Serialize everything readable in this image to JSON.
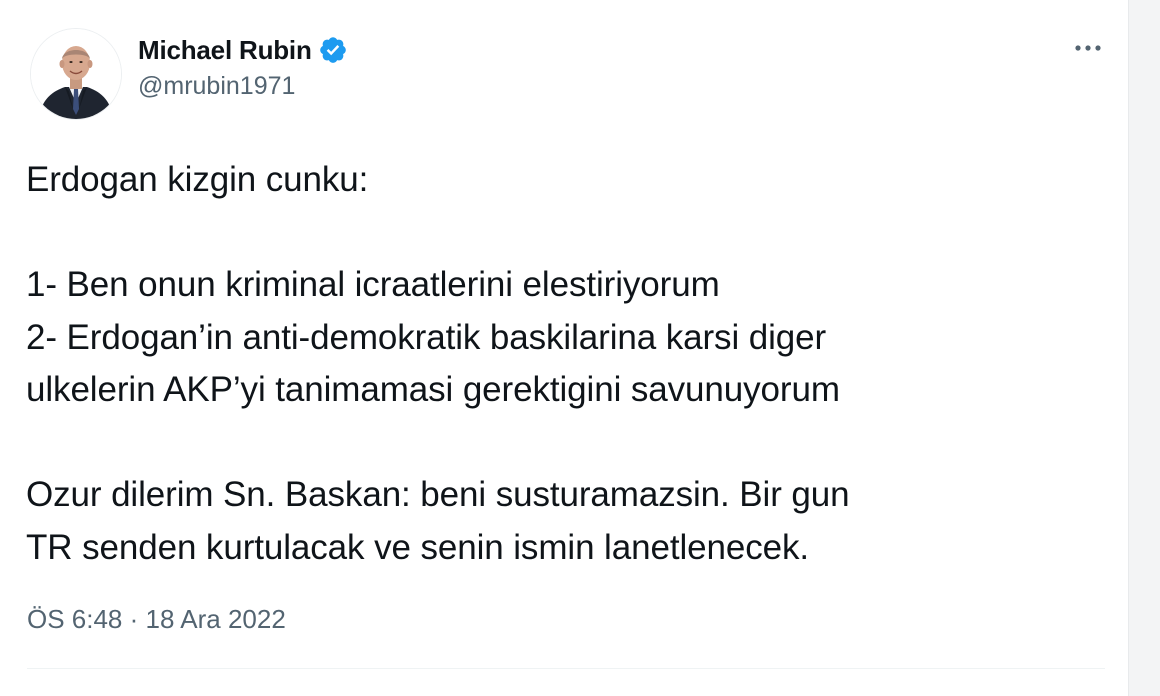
{
  "author": {
    "display_name": "Michael Rubin",
    "handle": "@mrubin1971",
    "verified": true,
    "avatar": "profile-photo"
  },
  "tweet": {
    "lines": [
      "Erdogan kizgin cunku:",
      "",
      "1- Ben onun kriminal icraatlerini elestiriyorum",
      "2- Erdogan’in anti-demokratik baskilarina karsi diger",
      "ulkelerin AKP’yi tanimamasi gerektigini savunuyorum",
      "",
      "Ozur dilerim Sn. Baskan: beni susturamazsin. Bir gun",
      "TR senden kurtulacak ve senin ismin lanetlenecek."
    ],
    "time": "ÖS 6:48",
    "separator": "·",
    "date": "18 Ara 2022"
  },
  "icons": {
    "more": "more-horizontal-icon",
    "verified": "verified-badge-icon"
  },
  "colors": {
    "verified_blue": "#1d9bf0",
    "text_primary": "#0f1419",
    "text_secondary": "#536471"
  }
}
